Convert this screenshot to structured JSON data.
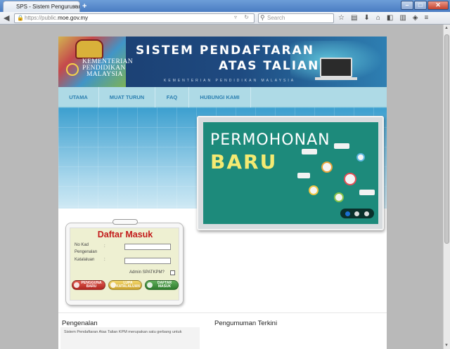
{
  "browser": {
    "tab_title": "SPS - Sistem Pengurusan ...",
    "tab_close": "×",
    "new_tab": "+",
    "url_scheme": "https://public.",
    "url_host": "moe.gov.my",
    "search_placeholder": "Search",
    "window_buttons": [
      "–",
      "□",
      "✕"
    ]
  },
  "banner": {
    "org_line1": "KEMENTERIAN",
    "org_line2": "PENDIDIKAN",
    "org_line3": "MALAYSIA",
    "title_line1": "SISTEM PENDAFTARAN",
    "title_line2": "ATAS TALIAN",
    "subtitle": "KEMENTERIAN PENDIDIKAN MALAYSIA"
  },
  "menu": {
    "items": [
      "UTAMA",
      "MUAT TURUN",
      "FAQ",
      "HUBUNGI KAMI"
    ]
  },
  "slider": {
    "title_line1": "PERMOHONAN",
    "title_line2": "BARU",
    "dots": 3,
    "active_dot": 1
  },
  "login": {
    "title": "Daftar Masuk",
    "label_nokad_1": "No Kad",
    "label_nokad_2": "Pengenalan",
    "label_password": "Katalaluan",
    "colon": ":",
    "admin_label": "Admin SPATKPM?",
    "btn_register": "PENGGUNA BARU",
    "btn_forgot": "LUPA KATALALUAN",
    "btn_login": "DAFTAR MASUK"
  },
  "sections": {
    "intro_title": "Pengenalan",
    "intro_text": "Sistem Pendaftaran Atas Talian KPM merupakan satu gerbang untuk",
    "announce_title": "Pengumuman Terkini"
  },
  "colors": {
    "menu_bg": "#aedae6",
    "menu_text": "#2b7fb0",
    "login_title": "#c21a1a",
    "slide_bg": "#1d8a7b"
  }
}
